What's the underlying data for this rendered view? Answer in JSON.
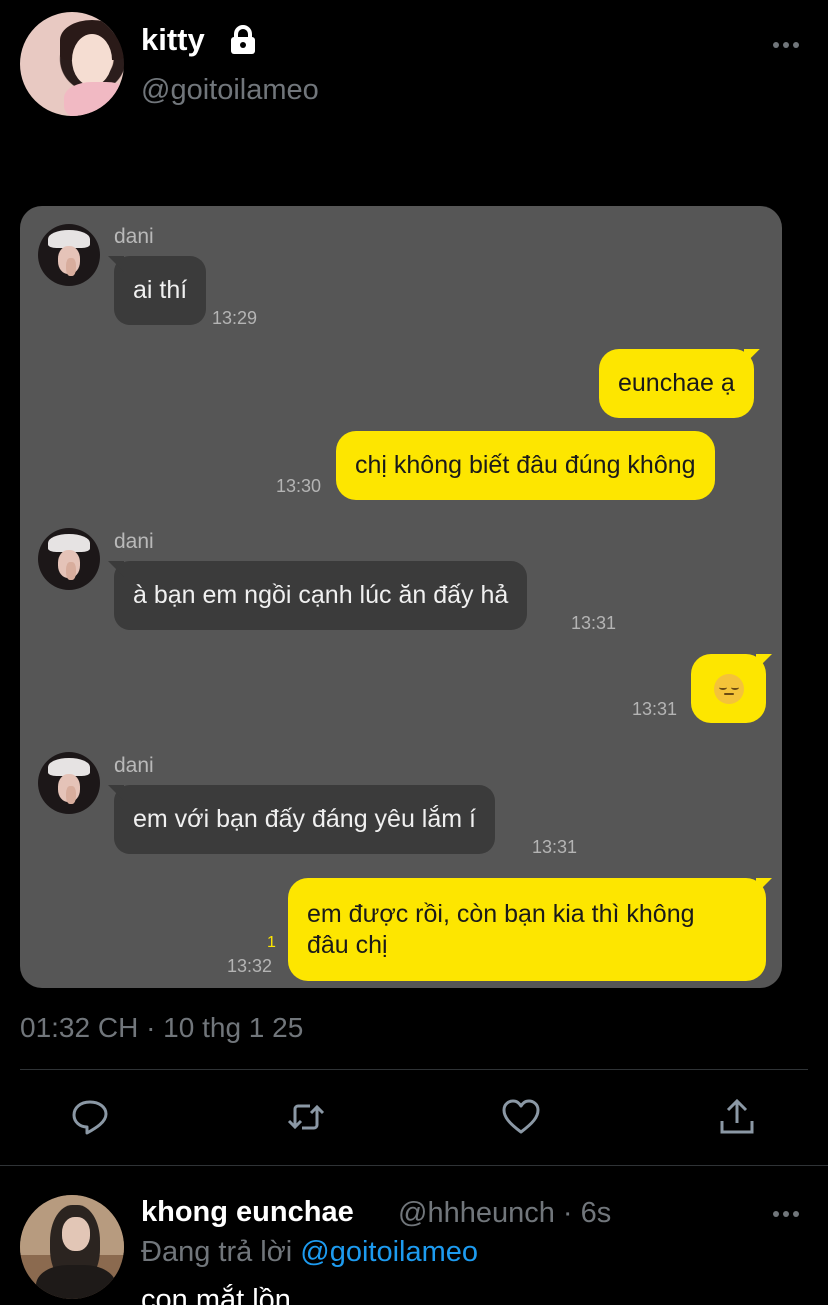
{
  "tweet": {
    "display_name": "kitty",
    "handle": "@goitoilameo",
    "timestamp": "01:32 CH · 10 thg 1 25"
  },
  "chat": {
    "messages": [
      {
        "sender": "dani",
        "text": "ai thí",
        "time": "13:29"
      },
      {
        "text": "eunchae ạ"
      },
      {
        "text": "chị không biết đâu đúng không",
        "time": "13:30"
      },
      {
        "sender": "dani",
        "text": "à bạn em ngồi cạnh lúc ăn đấy hả",
        "time": "13:31"
      },
      {
        "emoji": "relieved-face-emoji",
        "time": "13:31"
      },
      {
        "sender": "dani",
        "text": "em với bạn đấy đáng yêu lắm í",
        "time": "13:31"
      },
      {
        "text_line1": "em được rồi, còn bạn kia thì không",
        "text_line2": "đâu chị",
        "time": "13:32",
        "unread": "1"
      }
    ]
  },
  "reply": {
    "display_name": "khong eunchae",
    "meta": "@hhheunch · 6s",
    "replying_prefix": "Đang trả lời ",
    "replying_to": "@goitoilameo",
    "text": "con mắt lồn"
  },
  "colors": {
    "background": "#000000",
    "chat_bg": "#565656",
    "bubble_out": "#fde600",
    "bubble_in": "#3b3b3b",
    "secondary_text": "#71767b",
    "link": "#1d9bf0"
  }
}
